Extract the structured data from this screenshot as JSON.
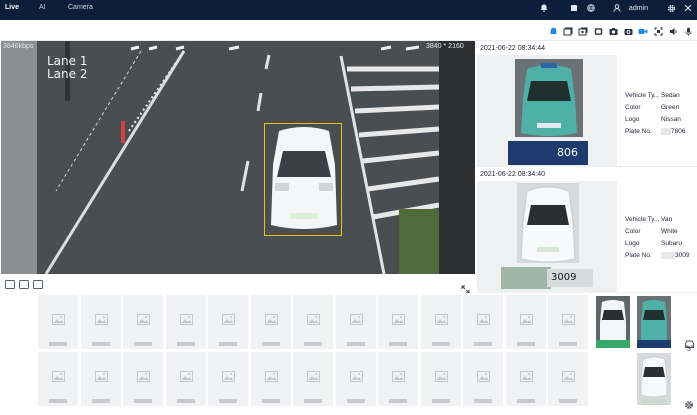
{
  "nav": {
    "items": [
      {
        "label": "Live",
        "active": true
      },
      {
        "label": "AI",
        "active": false
      },
      {
        "label": "Camera",
        "active": false
      }
    ]
  },
  "header": {
    "user": "admin"
  },
  "toolbar_icons": [
    "bell-icon",
    "snapshot-icon",
    "record-icon",
    "monitor-icon",
    "camera-icon",
    "capture-icon",
    "video-camera-icon",
    "fullscreen-icon",
    "volume-icon",
    "microphone-icon"
  ],
  "video": {
    "bitrate": "3846kbps",
    "resolution": "3840 * 2160",
    "lanes": [
      "Lane 1",
      "Lane 2"
    ],
    "controls": [
      "zoom-out-icon",
      "fit-window-icon",
      "original-size-icon"
    ]
  },
  "captures": [
    {
      "time": "2021-06-22 08:34:44",
      "plate_image_text": "806",
      "attributes": [
        {
          "key": "Vehicle Ty...",
          "value": "Sedan"
        },
        {
          "key": "Color",
          "value": "Green"
        },
        {
          "key": "Logo",
          "value": "Nissan"
        },
        {
          "key": "Plate No.",
          "value": "7806"
        }
      ]
    },
    {
      "time": "2021-06-22 08:34:40",
      "plate_image_text": "3009",
      "attributes": [
        {
          "key": "Vehicle Ty...",
          "value": "Van"
        },
        {
          "key": "Color",
          "value": "White"
        },
        {
          "key": "Logo",
          "value": "Subaru"
        },
        {
          "key": "Plate No.",
          "value": "3009"
        }
      ]
    }
  ],
  "sidebar": {
    "vehicle_count": "3"
  },
  "colors": {
    "topbar": "#0b1f3a",
    "accent": "#1e88e5",
    "bbox": "#e4c21f"
  }
}
